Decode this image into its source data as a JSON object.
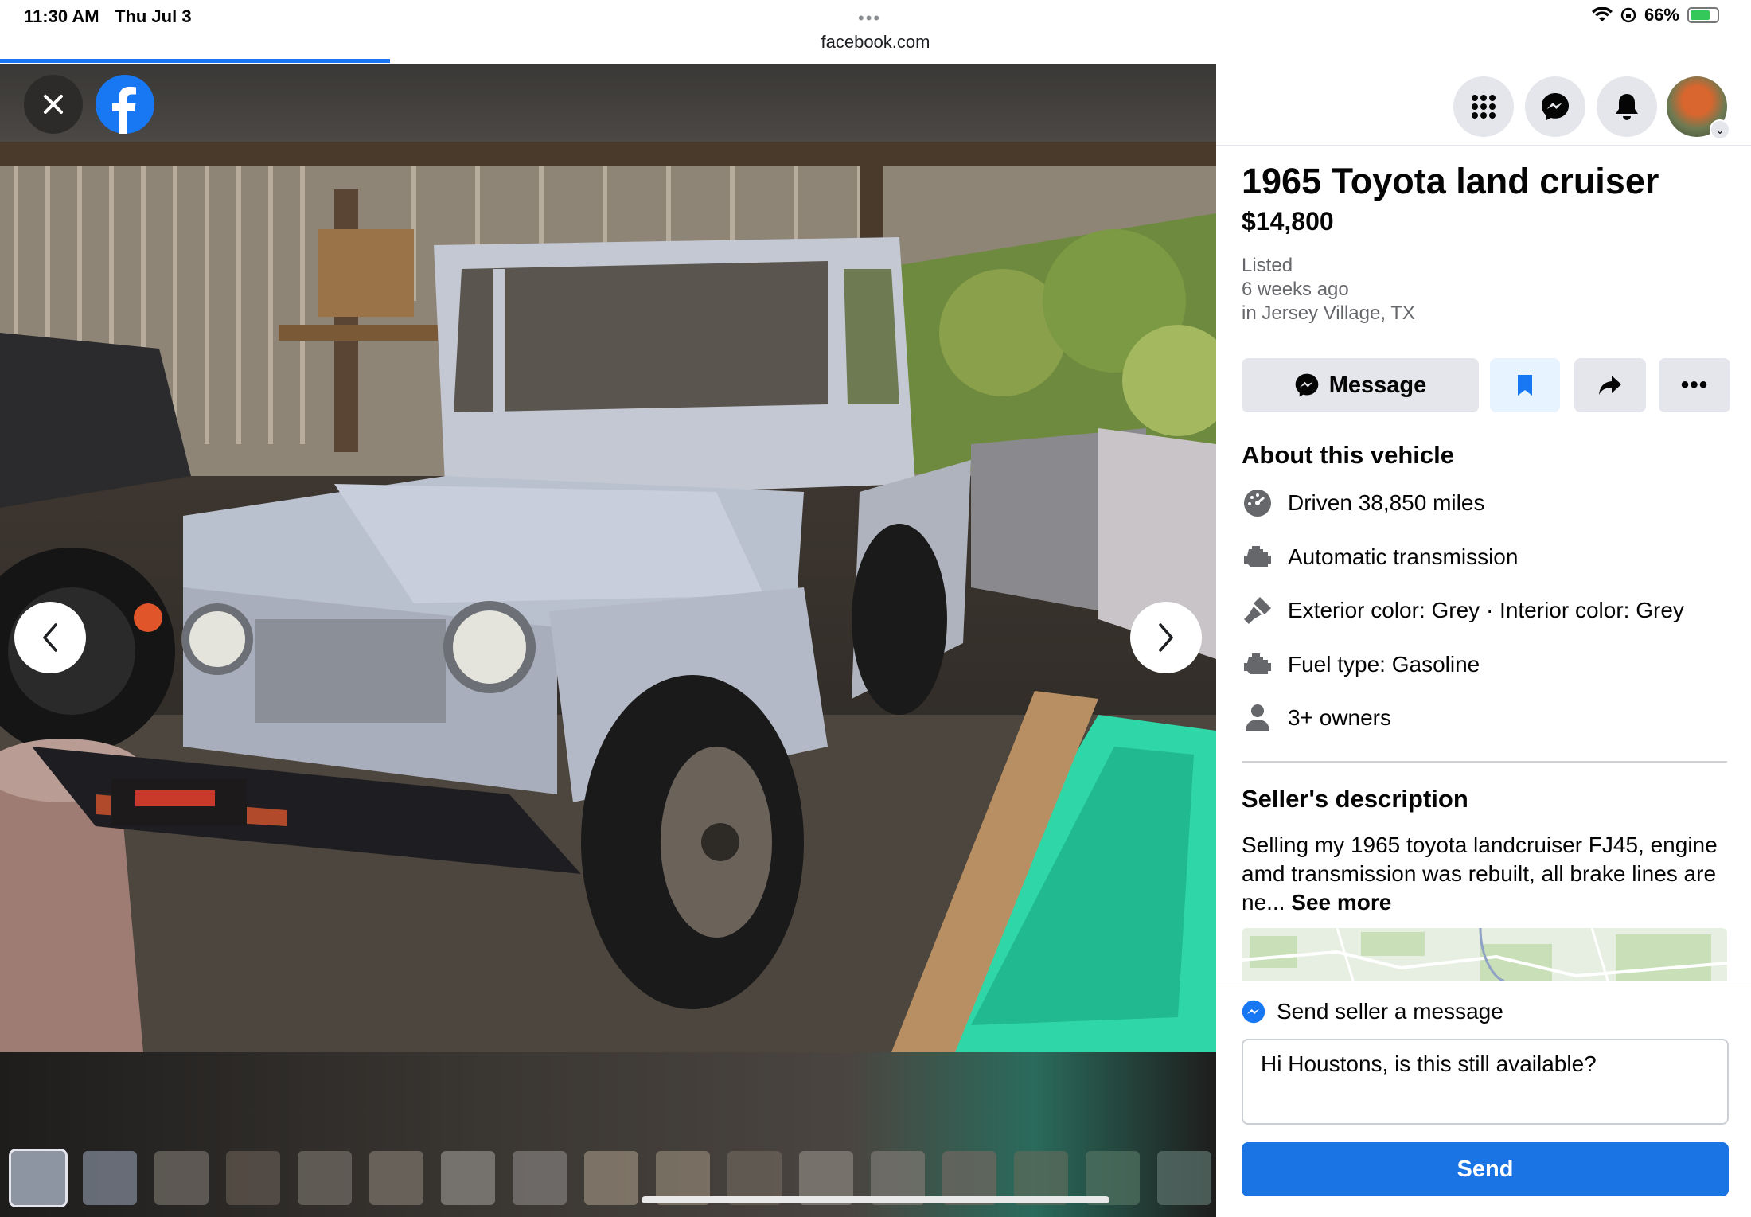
{
  "status_bar": {
    "time": "11:30 AM",
    "date": "Thu Jul 3",
    "menu_dots": "•••",
    "url": "facebook.com",
    "battery": "66%"
  },
  "colors": {
    "facebook_blue": "#1877f2",
    "send_button": "#1b74e4",
    "secondary_text": "#65676b",
    "button_gray": "#e4e6eb"
  },
  "viewer": {
    "thumbnail_count": 17,
    "active_thumbnail": 1
  },
  "listing": {
    "title": "1965 Toyota land cruiser",
    "price": "$14,800",
    "listed_label": "Listed",
    "listed_time": "6 weeks ago",
    "location": "in Jersey Village, TX"
  },
  "actions": {
    "message_label": "Message",
    "save_icon": "bookmark-icon",
    "share_icon": "share-icon",
    "more_label": "•••"
  },
  "about": {
    "title": "About this vehicle",
    "details": [
      {
        "icon": "speedometer-icon",
        "text": "Driven 38,850 miles"
      },
      {
        "icon": "engine-icon",
        "text": "Automatic transmission"
      },
      {
        "icon": "paint-icon",
        "text": "Exterior color: Grey · Interior color: Grey"
      },
      {
        "icon": "engine-icon",
        "text": "Fuel type: Gasoline"
      },
      {
        "icon": "person-icon",
        "text": "3+ owners"
      }
    ]
  },
  "seller": {
    "title": "Seller's description",
    "description": "Selling my 1965 toyota landcruiser FJ45, engine amd transmission was rebuilt, all brake lines are ne... ",
    "see_more": "See more"
  },
  "compose": {
    "label": "Send seller a message",
    "message": "Hi Houstons, is this still available?",
    "send_label": "Send"
  }
}
